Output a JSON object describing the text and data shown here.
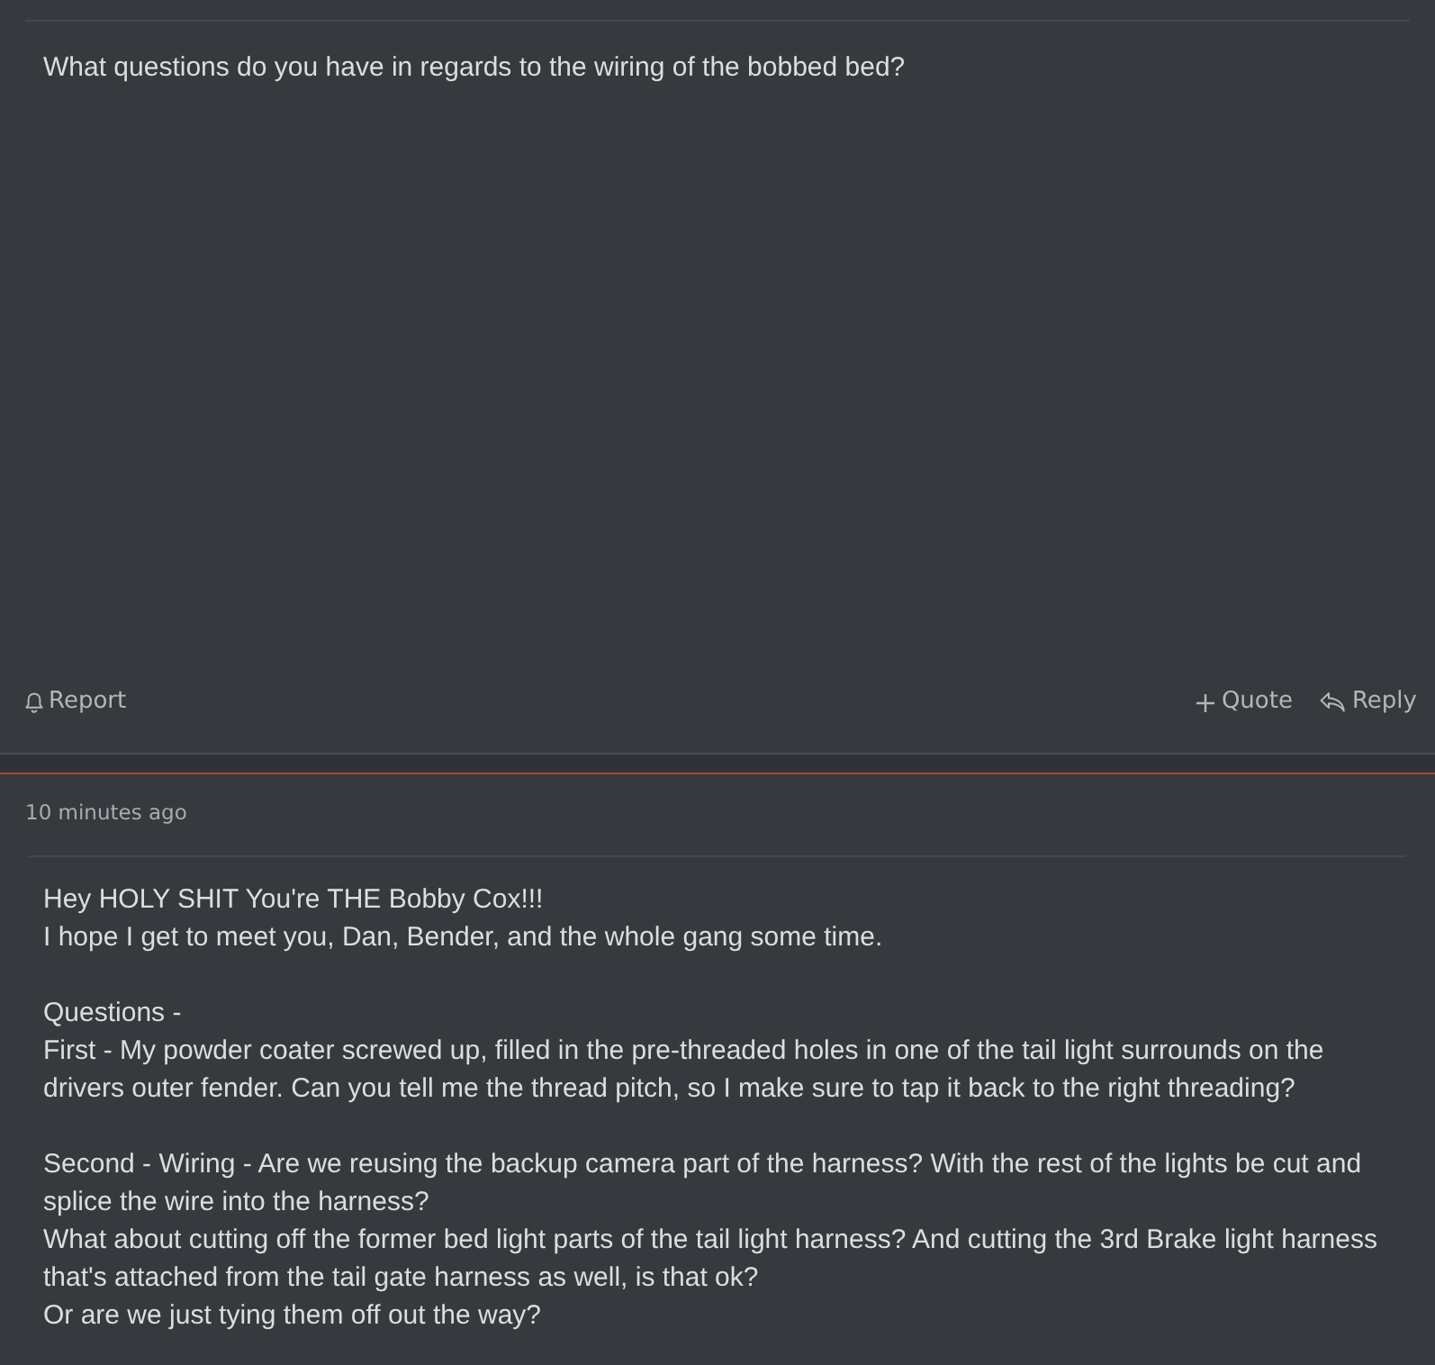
{
  "posts": [
    {
      "body": [
        [
          "What questions do you have in regards to the wiring of the bobbed bed?"
        ]
      ],
      "actions": [
        {
          "kind": "report",
          "label": "Report"
        },
        {
          "kind": "quote",
          "label": "Quote"
        },
        {
          "kind": "reply",
          "label": "Reply"
        }
      ]
    },
    {
      "timestamp": "10 minutes ago",
      "body": [
        [
          "Hey HOLY SHIT You're THE Bobby Cox!!!",
          "I hope I get to meet you, Dan, Bender, and the whole gang some time."
        ],
        [
          "Questions -",
          "First - My powder coater screwed up, filled in the pre-threaded holes in one of the tail light surrounds on the drivers outer fender. Can you tell me the thread pitch, so I make sure to tap it back to the right threading?"
        ],
        [
          "Second - Wiring - Are we reusing the backup camera part of the harness? With the rest of the lights be cut and splice the wire into the harness?",
          "What about cutting off the former bed light parts of the tail light harness? And cutting the 3rd Brake light harness that's attached from the tail gate harness as well, is that ok?",
          "Or are we just tying them off out the way?"
        ]
      ]
    }
  ]
}
